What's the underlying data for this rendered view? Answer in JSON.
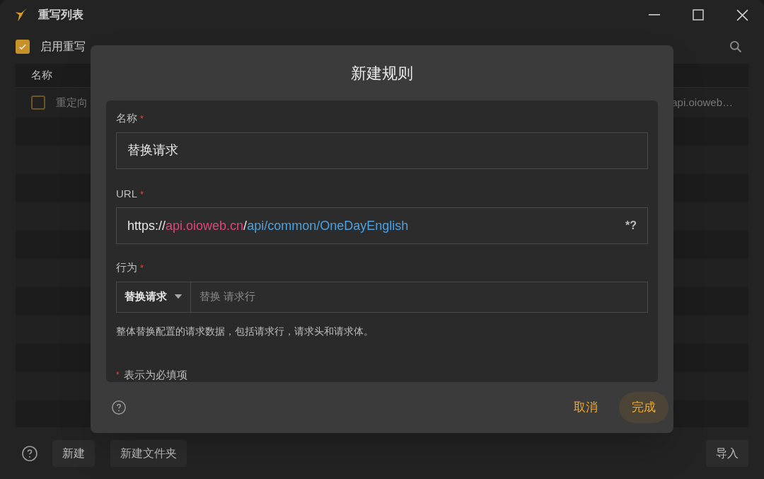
{
  "window": {
    "title": "重写列表"
  },
  "toolbar": {
    "enable_rewrite": {
      "label": "启用重写",
      "checked": true
    }
  },
  "table": {
    "columns": [
      "名称"
    ],
    "rows": [
      {
        "name": "重定向",
        "checked": false,
        "url": "api.oioweb…"
      }
    ]
  },
  "bottom_bar": {
    "buttons": [
      "新建",
      "新建文件夹"
    ],
    "right_button": "导入"
  },
  "dialog": {
    "title": "新建规则",
    "required_mark": "*",
    "fields": [
      {
        "kind": "text",
        "label": "名称",
        "required": true,
        "value": "替换请求"
      },
      {
        "kind": "url",
        "label": "URL",
        "required": true,
        "suffix": "*?",
        "segments": [
          {
            "text": "https://",
            "color": "#e6e6e6"
          },
          {
            "text": "api.oioweb.cn",
            "color": "#e0457b"
          },
          {
            "text": "/",
            "color": "#e6e6e6"
          },
          {
            "text": "api/common/OneDayEnglish",
            "color": "#4ea1e0"
          }
        ]
      },
      {
        "kind": "action",
        "label": "行为",
        "required": true,
        "select": "替换请求",
        "placeholder": "替换 请求行"
      }
    ],
    "description": "整体替换配置的请求数据，包括请求行，请求头和请求体。",
    "required_note": "表示为必填项",
    "cancel": "取消",
    "done": "完成"
  }
}
